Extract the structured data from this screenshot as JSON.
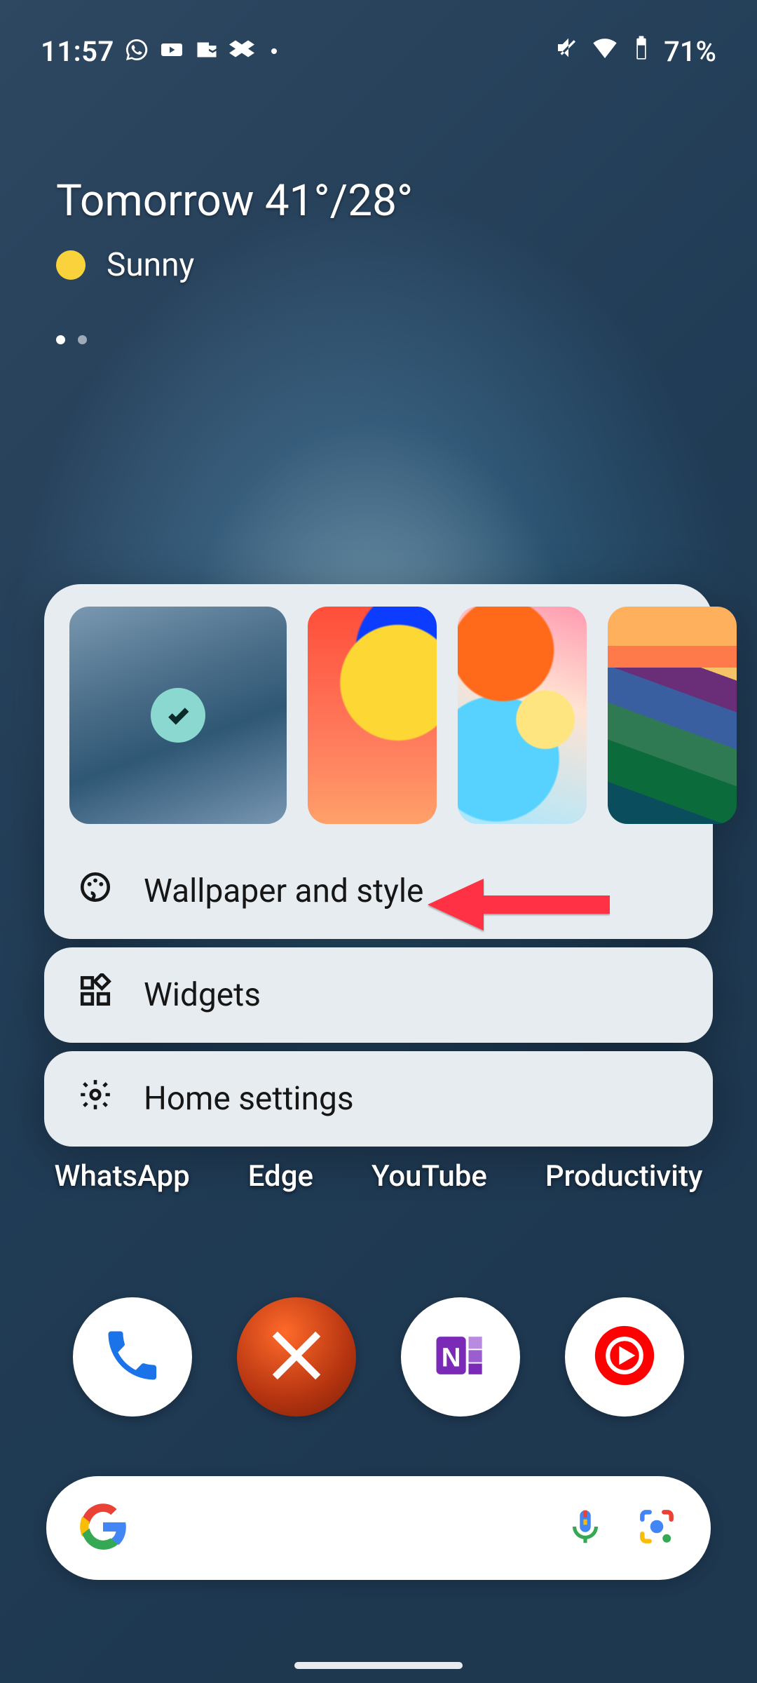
{
  "status_bar": {
    "time": "11:57",
    "battery_percent": "71%"
  },
  "weather": {
    "headline": "Tomorrow 41°/28°",
    "condition": "Sunny"
  },
  "context_menu": {
    "wallpaper_and_style": "Wallpaper and style",
    "widgets": "Widgets",
    "home_settings": "Home settings"
  },
  "app_labels": {
    "whatsapp": "WhatsApp",
    "edge": "Edge",
    "youtube": "YouTube",
    "productivity": "Productivity"
  }
}
